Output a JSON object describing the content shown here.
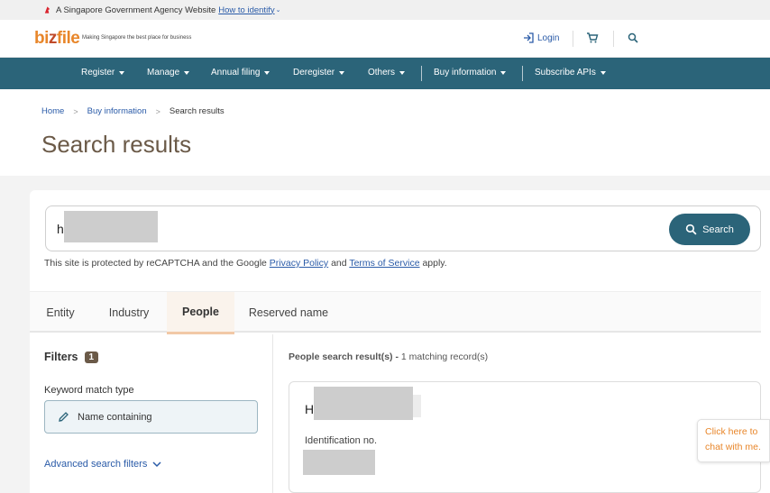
{
  "gov_banner": {
    "text": "A Singapore Government Agency Website",
    "identify_link": "How to identify"
  },
  "brand": {
    "logo_text_a": "bi",
    "logo_text_z": "z",
    "logo_text_b": "file",
    "tagline": "Making Singapore the best place for business",
    "login": "Login"
  },
  "nav": {
    "items": [
      {
        "label": "Register"
      },
      {
        "label": "Manage"
      },
      {
        "label": "Annual filing"
      },
      {
        "label": "Deregister"
      },
      {
        "label": "Others"
      },
      {
        "label": "Buy information"
      },
      {
        "label": "Subscribe APIs"
      }
    ]
  },
  "breadcrumb": {
    "home": "Home",
    "buy_info": "Buy information",
    "current": "Search results"
  },
  "page_title": "Search results",
  "search": {
    "value": "h",
    "button_label": "Search"
  },
  "recaptcha": {
    "prefix": "This site is protected by reCAPTCHA and the Google",
    "privacy": "Privacy Policy",
    "and": "and",
    "terms": "Terms of Service",
    "suffix": "apply."
  },
  "tabs": [
    {
      "label": "Entity"
    },
    {
      "label": "Industry"
    },
    {
      "label": "People",
      "active": true
    },
    {
      "label": "Reserved name"
    }
  ],
  "filters": {
    "title": "Filters",
    "count": "1",
    "keyword_label": "Keyword match type",
    "keyword_value": "Name containing",
    "advanced": "Advanced search filters"
  },
  "results": {
    "heading": "People search result(s) -",
    "count_text": "1 matching record(s)",
    "item": {
      "name_initial": "H",
      "id_label": "Identification no."
    }
  },
  "chat": {
    "line1": "Click here to",
    "line2": "chat with me."
  },
  "colors": {
    "nav_bg": "#2b6479",
    "title_brown": "#6b5a48",
    "link_blue": "#2a5ba8",
    "brand_orange": "#e8862a"
  }
}
